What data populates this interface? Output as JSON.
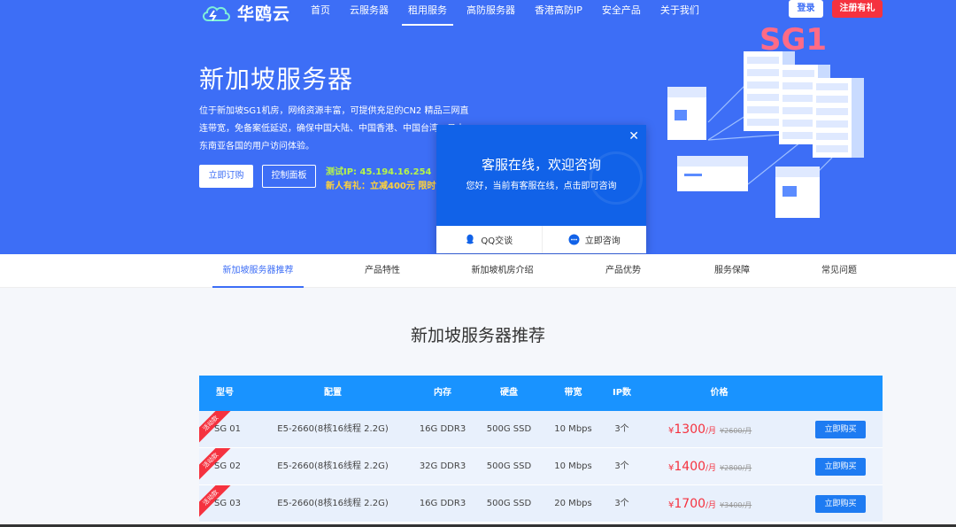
{
  "nav": {
    "logo_text": "华鸥云",
    "links": [
      "首页",
      "云服务器",
      "租用服务",
      "高防服务器",
      "香港高防IP",
      "安全产品",
      "关于我们"
    ],
    "active_index": 2,
    "login": "登录",
    "register": "注册有礼"
  },
  "hero": {
    "title": "新加坡服务器",
    "description": "位于新加坡SG1机房，网络资源丰富，可提供充足的CN2 精品三网直连带宽，免备案低延迟，确保中国大陆、中国香港、中国台湾、日本、东南亚各国的用户访问体验。",
    "order_button": "立即订购",
    "panel_button": "控制面板",
    "test_ip": "测试IP: 45.194.16.254",
    "promo": "新人有礼：立减400元 限时领取"
  },
  "illustration": {
    "sign": "SG1"
  },
  "chat": {
    "title": "客服在线，欢迎咨询",
    "subtitle": "您好，当前有客服在线，点击即可咨询",
    "qq": "QQ交谈",
    "consult": "立即咨询"
  },
  "tabs": [
    "新加坡服务器推荐",
    "产品特性",
    "新加坡机房介绍",
    "产品优势",
    "服务保障",
    "常见问题"
  ],
  "section_title": "新加坡服务器推荐",
  "table": {
    "headers": [
      "型号",
      "配置",
      "内存",
      "硬盘",
      "带宽",
      "IP数",
      "价格"
    ],
    "ribbon": "活动款",
    "buy_label": "立即购买",
    "rows": [
      {
        "model": "SG 01",
        "config": "E5-2660(8核16线程 2.2G)",
        "memory": "16G DDR3",
        "disk": "500G SSD",
        "bandwidth": "10 Mbps",
        "ips": "3个",
        "currency": "¥",
        "price": "1300",
        "unit": "/月",
        "old": "¥2600/月"
      },
      {
        "model": "SG 02",
        "config": "E5-2660(8核16线程 2.2G)",
        "memory": "32G DDR3",
        "disk": "500G SSD",
        "bandwidth": "10 Mbps",
        "ips": "3个",
        "currency": "¥",
        "price": "1400",
        "unit": "/月",
        "old": "¥2800/月"
      },
      {
        "model": "SG 03",
        "config": "E5-2660(8核16线程 2.2G)",
        "memory": "16G DDR3",
        "disk": "500G SSD",
        "bandwidth": "20 Mbps",
        "ips": "3个",
        "currency": "¥",
        "price": "1700",
        "unit": "/月",
        "old": "¥3400/月"
      }
    ]
  },
  "colors": {
    "primary": "#3d6ef6",
    "chat": "#1162e8",
    "table_head": "#1993ff",
    "accent_red": "#f5323f"
  }
}
